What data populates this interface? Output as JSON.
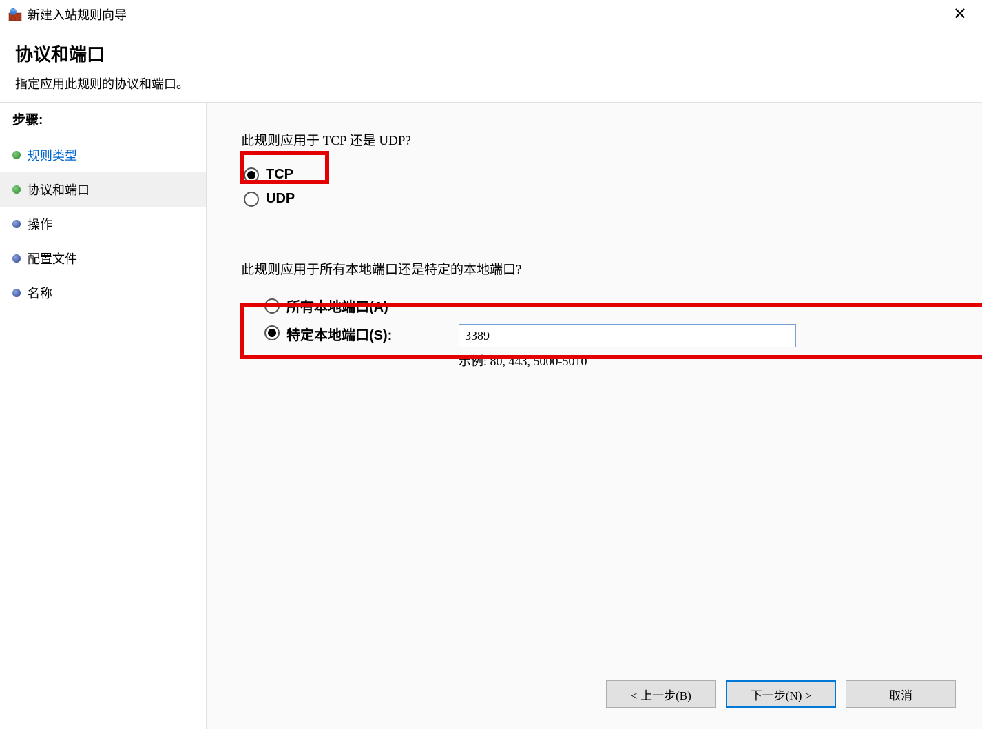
{
  "window": {
    "title": "新建入站规则向导",
    "close_icon": "✕"
  },
  "header": {
    "title": "协议和端口",
    "subtitle": "指定应用此规则的协议和端口。"
  },
  "sidebar": {
    "heading": "步骤:",
    "items": [
      {
        "label": "规则类型",
        "state": "done",
        "link": true
      },
      {
        "label": "协议和端口",
        "state": "done",
        "current": true
      },
      {
        "label": "操作",
        "state": "pending"
      },
      {
        "label": "配置文件",
        "state": "pending"
      },
      {
        "label": "名称",
        "state": "pending"
      }
    ]
  },
  "main": {
    "proto_question": "此规则应用于 TCP 还是 UDP?",
    "proto_options": {
      "tcp": "TCP",
      "udp": "UDP",
      "selected": "tcp"
    },
    "port_question": "此规则应用于所有本地端口还是特定的本地端口?",
    "port_options": {
      "all_label": "所有本地端口(A)",
      "specific_label": "特定本地端口(S):",
      "selected": "specific",
      "specific_value": "3389",
      "example": "示例: 80, 443, 5000-5010"
    }
  },
  "footer": {
    "back": "< 上一步(B)",
    "next": "下一步(N) >",
    "cancel": "取消"
  }
}
